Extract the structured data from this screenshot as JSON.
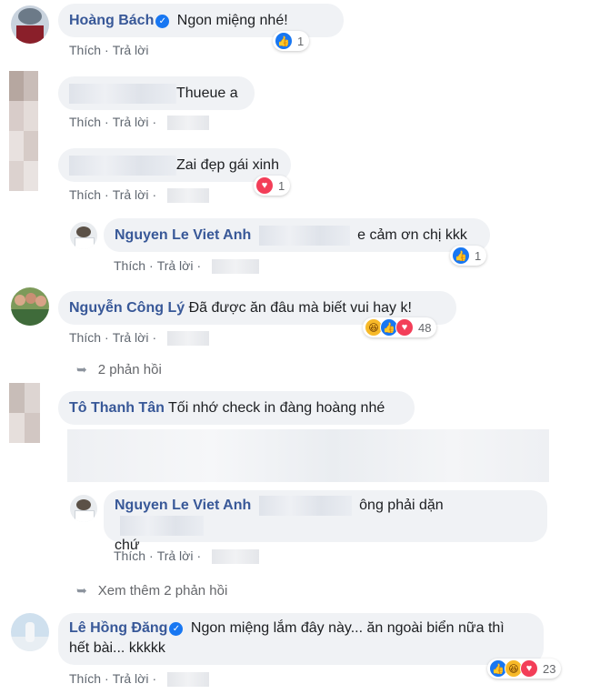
{
  "actions": {
    "like": "Thích",
    "reply": "Trả lời",
    "sep": "·"
  },
  "comments": {
    "c1": {
      "author": "Hoàng Bách",
      "verified": true,
      "text": "Ngon miệng nhé!",
      "reaction_count": "1"
    },
    "c2": {
      "text": "Thueue a"
    },
    "c3": {
      "text": "Zai đẹp gái xinh",
      "reaction_count": "1"
    },
    "r1": {
      "author": "Nguyen Le Viet Anh",
      "text": "e cảm ơn chị kkk",
      "reaction_count": "1"
    },
    "c4": {
      "author": "Nguyễn Công Lý",
      "text": "Đã được ăn đâu mà biết vui hay k!",
      "reaction_count": "48",
      "replies_link": "2 phản hồi"
    },
    "c5": {
      "author": "Tô Thanh Tân",
      "text": "Tối nhớ check in đàng hoàng nhé"
    },
    "r2": {
      "author": "Nguyen Le Viet Anh",
      "text_line1": "ông phải dặn",
      "text_line2": "chứ",
      "more_replies": "Xem thêm 2 phản hồi"
    },
    "c6": {
      "author": "Lê Hồng Đăng",
      "verified": true,
      "text_line1": "Ngon miệng lắm đây này... ăn ngoài biển nữa thì",
      "text_line2": "hết bài... kkkkk",
      "reaction_count": "23"
    }
  },
  "icons": {
    "like": "like-icon",
    "love": "love-icon",
    "haha": "haha-icon",
    "verified": "verified-badge-icon",
    "reply-arrow": "reply-arrow-icon"
  },
  "colors": {
    "name": "#385898",
    "bubble": "#f0f2f5",
    "meta": "#606770",
    "like": "#1877f2",
    "love": "#f33e58",
    "haha": "#f7b928"
  }
}
